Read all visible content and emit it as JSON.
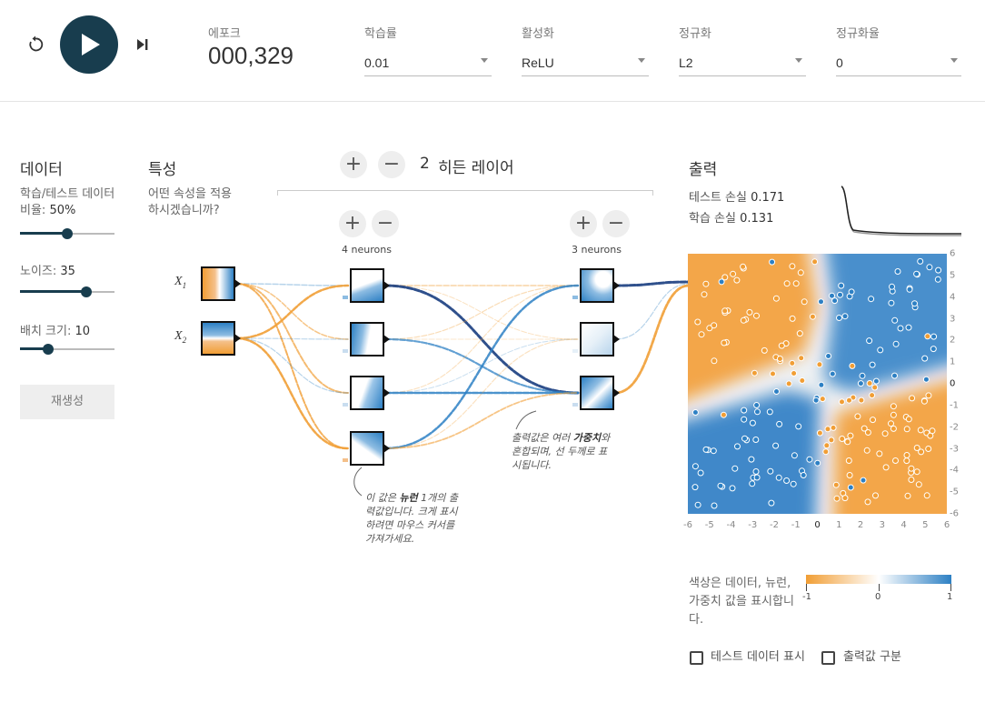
{
  "controls": {
    "reset_icon": "reset-icon",
    "play_icon": "play-icon",
    "step_icon": "step-icon"
  },
  "epoch": {
    "label": "에포크",
    "value": "000,329"
  },
  "dropdowns": [
    {
      "label": "학습률",
      "value": "0.01"
    },
    {
      "label": "활성화",
      "value": "ReLU"
    },
    {
      "label": "정규화",
      "value": "L2"
    },
    {
      "label": "정규화율",
      "value": "0"
    }
  ],
  "data_panel": {
    "title": "데이터",
    "ratio_label": "학습/테스트 데이터 비율:",
    "ratio_value": "50%",
    "ratio_level": 0.5,
    "noise_label": "노이즈:",
    "noise_value": "35",
    "noise_level": 0.7,
    "batch_label": "배치 크기:",
    "batch_value": "10",
    "batch_level": 0.3,
    "regenerate": "재생성"
  },
  "features": {
    "title": "특성",
    "question": "어떤 속성을 적용하시겠습니까?",
    "x1": "X",
    "x1_sub": "1",
    "x2": "X",
    "x2_sub": "2"
  },
  "hidden": {
    "add": "+",
    "remove": "−",
    "count": "2",
    "title": "히든 레이어",
    "layer1_neurons": "4 neurons",
    "layer2_neurons": "3 neurons",
    "note1_pre": "이 값은 ",
    "note1_bold": "뉴런",
    "note1_post": " 1개의 출력값입니다. 크게 표시하려면 마우스 커서를 가져가세요.",
    "note2_pre": "출력값은 여러 ",
    "note2_bold": "가중치",
    "note2_post": "와 혼합되며, 선 두께로 표시됩니다."
  },
  "output": {
    "title": "출력",
    "test_loss_label": "테스트 손실",
    "test_loss": "0.171",
    "train_loss_label": "학습 손실",
    "train_loss": "0.131",
    "x_ticks": [
      "-6",
      "-5",
      "-4",
      "-3",
      "-2",
      "-1",
      "0",
      "1",
      "2",
      "3",
      "4",
      "5",
      "6"
    ],
    "y_ticks": [
      "6",
      "5",
      "4",
      "3",
      "2",
      "1",
      "0",
      "-1",
      "-2",
      "-3",
      "-4",
      "-5",
      "-6"
    ],
    "legend_text": "색상은 데이터, 뉴런, 가중치 값을 표시합니다.",
    "legend_ticks": [
      "-1",
      "0",
      "1"
    ],
    "show_test_label": "테스트 데이터 표시",
    "discretize_label": "출력값 구분"
  },
  "colors": {
    "blue": "#2d80c4",
    "orange": "#f19e35",
    "dark": "#183d4e"
  }
}
